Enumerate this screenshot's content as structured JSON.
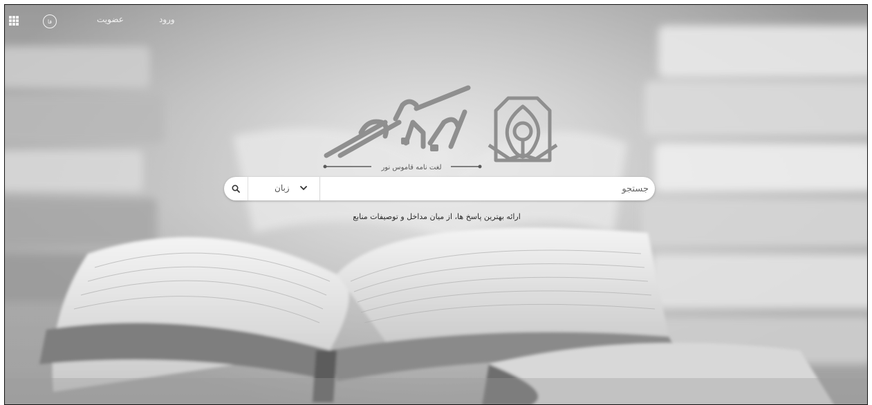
{
  "nav": {
    "login_label": "ورود",
    "register_label": "عضویت",
    "lang_badge": "فا",
    "apps_icon": "grid-icon"
  },
  "logo": {
    "subtitle": "لغت نامه قاموس نور"
  },
  "search": {
    "placeholder": "جستجو",
    "language_label": "زبان",
    "search_icon": "search-icon",
    "dropdown_icon": "chevron-down-icon"
  },
  "tagline": "ارائه بهترین پاسخ ها، از میان مداخل و توصیفات منابع",
  "colors": {
    "nav_text": "#f3f3f3",
    "search_bg": "#ffffff",
    "logo_gray": "#8f8f8f"
  }
}
